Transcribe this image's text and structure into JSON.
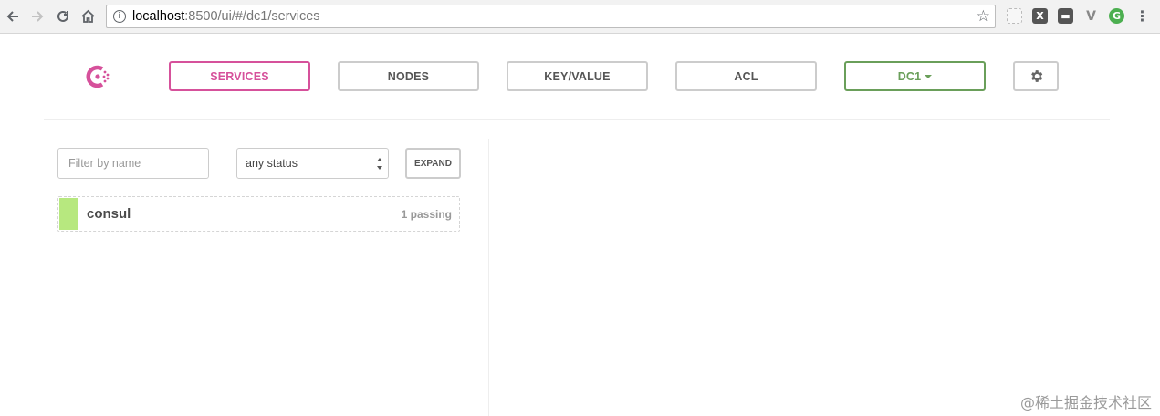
{
  "browser": {
    "url_host": "localhost",
    "url_path": ":8500/ui/#/dc1/services",
    "icons": [
      "back-arrow",
      "forward-arrow",
      "reload",
      "home",
      "info",
      "bookmark-star",
      "extension-grid",
      "extension-x",
      "extension-menu",
      "extension-v",
      "extension-g",
      "kebab-menu"
    ]
  },
  "header": {
    "logo": "consul-logo",
    "tabs": [
      {
        "label": "SERVICES",
        "active": true
      },
      {
        "label": "NODES"
      },
      {
        "label": "KEY/VALUE"
      },
      {
        "label": "ACL"
      }
    ],
    "datacenter": "DC1",
    "settings_icon": "gear-icon"
  },
  "filters": {
    "name_placeholder": "Filter by name",
    "status_value": "any status",
    "expand_label": "EXPAND"
  },
  "services": [
    {
      "name": "consul",
      "health": "1 passing",
      "status_color": "#b7e87f"
    }
  ],
  "colors": {
    "accent": "#d6519b",
    "datacenter": "#6a9f5a",
    "passing": "#b7e87f"
  },
  "watermark": "@稀土掘金技术社区"
}
